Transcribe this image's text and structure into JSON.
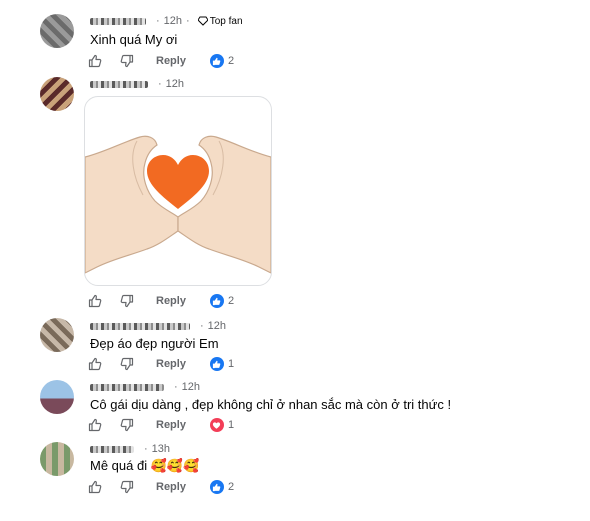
{
  "comments": [
    {
      "name_blur": true,
      "time": "12h",
      "badge": "Top fan",
      "text": "Xinh quá My ơi",
      "reply_label": "Reply",
      "reaction": "like",
      "count": "2"
    },
    {
      "name_blur": true,
      "time": "12h",
      "text": "",
      "sticker": "heart-hands",
      "reply_label": "Reply",
      "reaction": "like",
      "count": "2"
    },
    {
      "name_blur": true,
      "time": "12h",
      "text": "Đẹp áo đẹp người Em",
      "reply_label": "Reply",
      "reaction": "like",
      "count": "1"
    },
    {
      "name_blur": true,
      "time": "12h",
      "text": "Cô gái dịu dàng , đẹp không chỉ ở nhan sắc mà còn ở tri thức !",
      "reply_label": "Reply",
      "reaction": "love",
      "count": "1"
    },
    {
      "name_blur": true,
      "time": "13h",
      "text": "Mê quá đi 🥰🥰🥰",
      "reply_label": "Reply",
      "reaction": "like",
      "count": "2"
    }
  ],
  "colors": {
    "like": "#1877f2",
    "love": "#f33e58",
    "heart": "#f26a22"
  }
}
